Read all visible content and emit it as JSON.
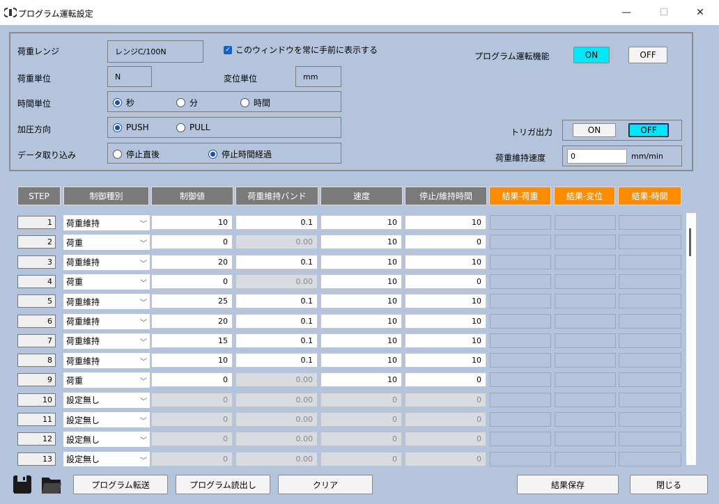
{
  "window": {
    "title": "プログラム運転設定",
    "minimize": "—",
    "maximize": "☐",
    "close": "✕"
  },
  "settings": {
    "load_range_label": "荷重レンジ",
    "load_range_value": "レンジC/100N",
    "always_on_top_label": "このウィンドウを常に手前に表示する",
    "program_function_label": "プログラム運転機能",
    "program_on": "ON",
    "program_off": "OFF",
    "load_unit_label": "荷重単位",
    "load_unit_value": "N",
    "disp_unit_label": "変位単位",
    "disp_unit_value": "mm",
    "time_unit_label": "時間単位",
    "time_options": [
      "秒",
      "分",
      "時間"
    ],
    "time_selected": 0,
    "press_dir_label": "加圧方向",
    "press_options": [
      "PUSH",
      "PULL"
    ],
    "press_selected": 0,
    "data_capture_label": "データ取り込み",
    "capture_options": [
      "停止直後",
      "停止時間経過"
    ],
    "capture_selected": 1,
    "trigger_label": "トリガ出力",
    "trigger_on": "ON",
    "trigger_off": "OFF",
    "hold_speed_label": "荷重維持速度",
    "hold_speed_value": "0",
    "hold_speed_unit": "mm/min"
  },
  "table": {
    "headers": [
      "STEP",
      "制御種別",
      "制御値",
      "荷重維持バンド",
      "速度",
      "停止/維持時間",
      "結果-荷重",
      "結果-変位",
      "結果-時間"
    ],
    "rows": [
      {
        "step": "1",
        "type": "荷重維持",
        "value": "10",
        "band": "0.1",
        "speed": "10",
        "time": "10",
        "active": true,
        "band_active": true
      },
      {
        "step": "2",
        "type": "荷重",
        "value": "0",
        "band": "0.00",
        "speed": "10",
        "time": "0",
        "active": true,
        "band_active": false
      },
      {
        "step": "3",
        "type": "荷重維持",
        "value": "20",
        "band": "0.1",
        "speed": "10",
        "time": "10",
        "active": true,
        "band_active": true
      },
      {
        "step": "4",
        "type": "荷重",
        "value": "0",
        "band": "0.00",
        "speed": "10",
        "time": "0",
        "active": true,
        "band_active": false
      },
      {
        "step": "5",
        "type": "荷重維持",
        "value": "25",
        "band": "0.1",
        "speed": "10",
        "time": "10",
        "active": true,
        "band_active": true
      },
      {
        "step": "6",
        "type": "荷重維持",
        "value": "20",
        "band": "0.1",
        "speed": "10",
        "time": "10",
        "active": true,
        "band_active": true
      },
      {
        "step": "7",
        "type": "荷重維持",
        "value": "15",
        "band": "0.1",
        "speed": "10",
        "time": "10",
        "active": true,
        "band_active": true
      },
      {
        "step": "8",
        "type": "荷重維持",
        "value": "10",
        "band": "0.1",
        "speed": "10",
        "time": "10",
        "active": true,
        "band_active": true
      },
      {
        "step": "9",
        "type": "荷重",
        "value": "0",
        "band": "0.00",
        "speed": "10",
        "time": "0",
        "active": true,
        "band_active": false
      },
      {
        "step": "10",
        "type": "設定無し",
        "value": "0",
        "band": "0.00",
        "speed": "0",
        "time": "0",
        "active": false,
        "band_active": false
      },
      {
        "step": "11",
        "type": "設定無し",
        "value": "0",
        "band": "0.00",
        "speed": "0",
        "time": "0",
        "active": false,
        "band_active": false
      },
      {
        "step": "12",
        "type": "設定無し",
        "value": "0",
        "band": "0.00",
        "speed": "0",
        "time": "0",
        "active": false,
        "band_active": false
      },
      {
        "step": "13",
        "type": "設定無し",
        "value": "0",
        "band": "0.00",
        "speed": "0",
        "time": "0",
        "active": false,
        "band_active": false
      }
    ]
  },
  "footer": {
    "save_icon": "floppy-disk-icon",
    "open_icon": "folder-icon",
    "transfer": "プログラム転送",
    "read": "プログラム読出し",
    "clear": "クリア",
    "save_results": "結果保存",
    "close": "閉じる"
  }
}
